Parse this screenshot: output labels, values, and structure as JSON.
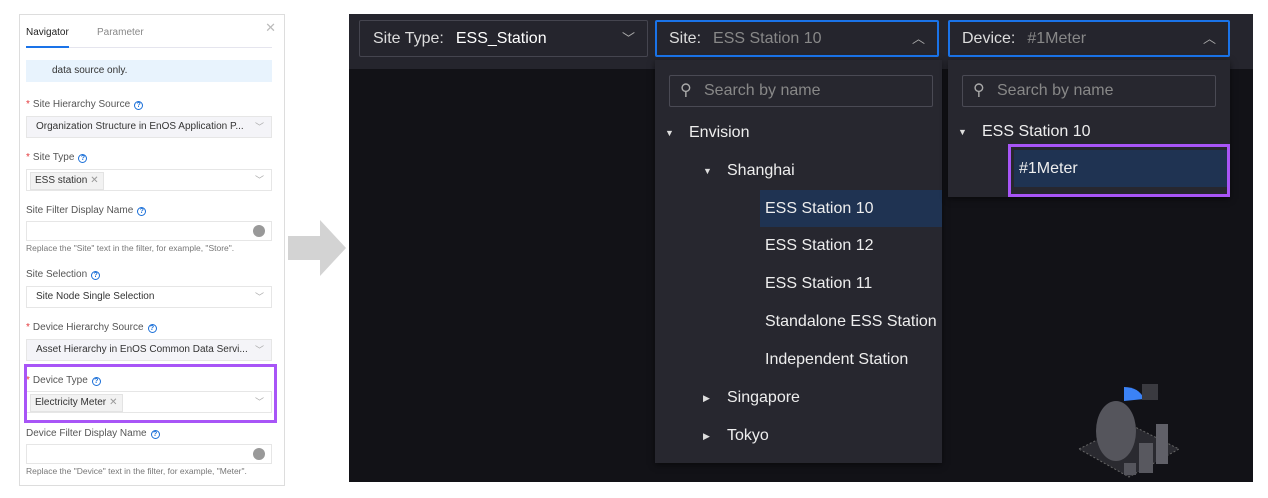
{
  "panel": {
    "tabs": [
      "Navigator",
      "Parameter"
    ],
    "info_text": "data source only.",
    "site_hierarchy_source": {
      "label": "Site Hierarchy Source",
      "value": "Organization Structure in EnOS Application P..."
    },
    "site_type": {
      "label": "Site Type",
      "tag": "ESS station"
    },
    "site_filter_display_name": {
      "label": "Site Filter Display Name",
      "value": "",
      "hint": "Replace the \"Site\" text in the filter, for example, \"Store\"."
    },
    "site_selection": {
      "label": "Site Selection",
      "value": "Site Node Single Selection"
    },
    "device_hierarchy_source": {
      "label": "Device Hierarchy Source",
      "value": "Asset Hierarchy in EnOS Common Data Servi..."
    },
    "device_type": {
      "label": "Device Type",
      "tag": "Electricity Meter"
    },
    "device_filter_display_name": {
      "label": "Device Filter Display Name",
      "value": "",
      "hint": "Replace the \"Device\" text in the filter, for example, \"Meter\"."
    }
  },
  "filters": {
    "site_type": {
      "label": "Site Type:",
      "value": "ESS_Station"
    },
    "site": {
      "label": "Site:",
      "value": "ESS Station 10"
    },
    "device": {
      "label": "Device:",
      "value": "#1Meter"
    }
  },
  "site_dropdown": {
    "search_placeholder": "Search by name",
    "root": "Envision",
    "city": "Shanghai",
    "stations": [
      "ESS Station 10",
      "ESS Station 12",
      "ESS Station 11",
      "Standalone ESS Station",
      "Independent Station"
    ],
    "collapsed": [
      "Singapore",
      "Tokyo"
    ]
  },
  "device_dropdown": {
    "search_placeholder": "Search by name",
    "root": "ESS Station 10",
    "device": "#1Meter"
  },
  "colors": {
    "accent": "#1a73e8",
    "highlight": "#a855f7",
    "selected": "#1f3352"
  }
}
